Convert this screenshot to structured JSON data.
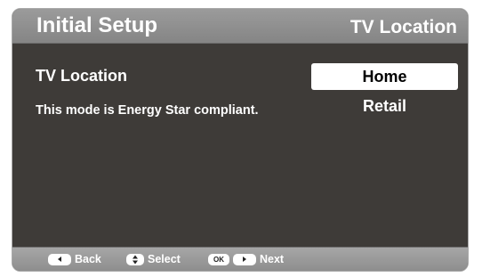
{
  "header": {
    "title": "Initial Setup",
    "subtitle": "TV Location"
  },
  "setting": {
    "label": "TV Location",
    "description": "This mode is Energy Star compliant."
  },
  "options": [
    {
      "label": "Home",
      "selected": true
    },
    {
      "label": "Retail",
      "selected": false
    }
  ],
  "footer": {
    "back_label": "Back",
    "select_label": "Select",
    "ok_key": "OK",
    "next_label": "Next"
  },
  "icons": {
    "back": "left-arrow-icon",
    "select": "up-down-arrows-icon",
    "next": "right-arrow-icon"
  },
  "colors": {
    "panel_background": "#3e3b38",
    "bar_background": "#9b9b9b",
    "selected_option_background": "#ffffff",
    "text": "#ffffff"
  }
}
